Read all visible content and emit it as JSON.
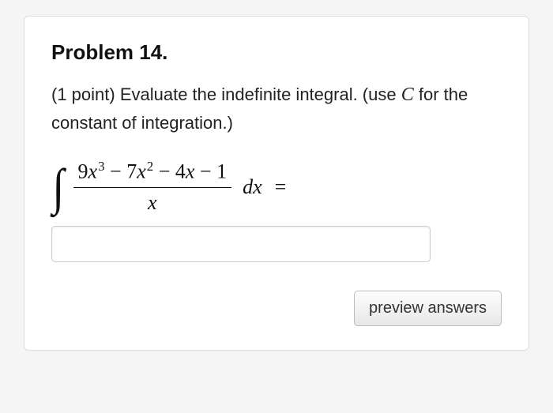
{
  "problem": {
    "title": "Problem 14.",
    "points_prefix": "(1 point) ",
    "prompt_main": "Evaluate the indefinite integral. (use ",
    "const_var": "C",
    "prompt_tail": " for the constant of integration.)",
    "integral": {
      "numerator_text": "9x³ − 7x² − 4x − 1",
      "denominator_text": "x",
      "differential": "dx",
      "equals": "="
    },
    "answer_value": ""
  },
  "actions": {
    "preview_label": "preview answers"
  }
}
